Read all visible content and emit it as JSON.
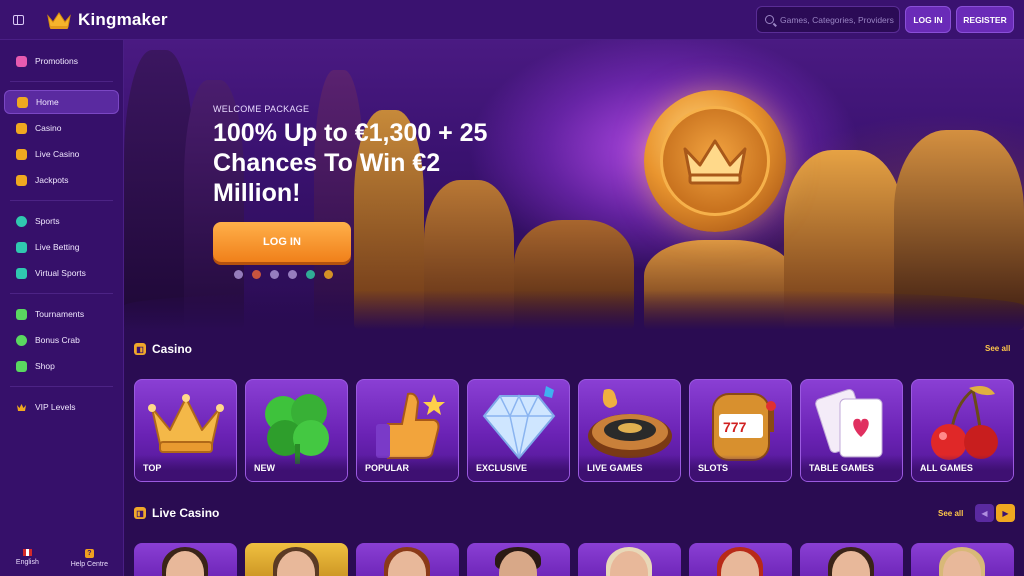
{
  "header": {
    "brand": "Kingmaker",
    "search_placeholder": "Games, Categories, Providers",
    "login_label": "LOG IN",
    "register_label": "REGISTER"
  },
  "sidebar": {
    "items": [
      {
        "label": "Promotions",
        "icon": "gift-icon",
        "color": "#e85ab0"
      },
      {
        "label": "Home",
        "icon": "home-icon",
        "color": "#f0a820",
        "active": true
      },
      {
        "label": "Casino",
        "icon": "slot-machine-icon",
        "color": "#f0a820"
      },
      {
        "label": "Live Casino",
        "icon": "cards-icon",
        "color": "#f0a820"
      },
      {
        "label": "Jackpots",
        "icon": "dice-icon",
        "color": "#f0a820"
      },
      {
        "label": "Sports",
        "icon": "football-icon",
        "color": "#30c8b0"
      },
      {
        "label": "Live Betting",
        "icon": "tv-icon",
        "color": "#30c8b0"
      },
      {
        "label": "Virtual Sports",
        "icon": "gamepad-icon",
        "color": "#30c8b0"
      },
      {
        "label": "Tournaments",
        "icon": "trophy-icon",
        "color": "#5ad860"
      },
      {
        "label": "Bonus Crab",
        "icon": "claw-icon",
        "color": "#5ad860"
      },
      {
        "label": "Shop",
        "icon": "shop-icon",
        "color": "#5ad860"
      },
      {
        "label": "VIP Levels",
        "icon": "crown-icon",
        "color": "#f0a820"
      }
    ],
    "language_label": "English",
    "help_label": "Help Centre"
  },
  "hero": {
    "kicker": "WELCOME PACKAGE",
    "title": "100% Up to €1,300 + 25 Chances To Win €2 Million!",
    "cta_label": "LOG IN"
  },
  "casino_section": {
    "title": "Casino",
    "see_all": "See all",
    "categories": [
      {
        "label": "TOP",
        "icon": "crown-icon"
      },
      {
        "label": "NEW",
        "icon": "clover-icon"
      },
      {
        "label": "POPULAR",
        "icon": "thumbs-up-icon"
      },
      {
        "label": "EXCLUSIVE",
        "icon": "diamond-icon"
      },
      {
        "label": "LIVE GAMES",
        "icon": "roulette-icon"
      },
      {
        "label": "SLOTS",
        "icon": "slot-machine-icon"
      },
      {
        "label": "TABLE GAMES",
        "icon": "playing-cards-icon"
      },
      {
        "label": "ALL GAMES",
        "icon": "cherries-icon"
      }
    ]
  },
  "live_section": {
    "title": "Live Casino",
    "see_all": "See all"
  },
  "colors": {
    "accent": "#f0a820",
    "background": "#2a0c52",
    "sidebar": "#36106a"
  }
}
